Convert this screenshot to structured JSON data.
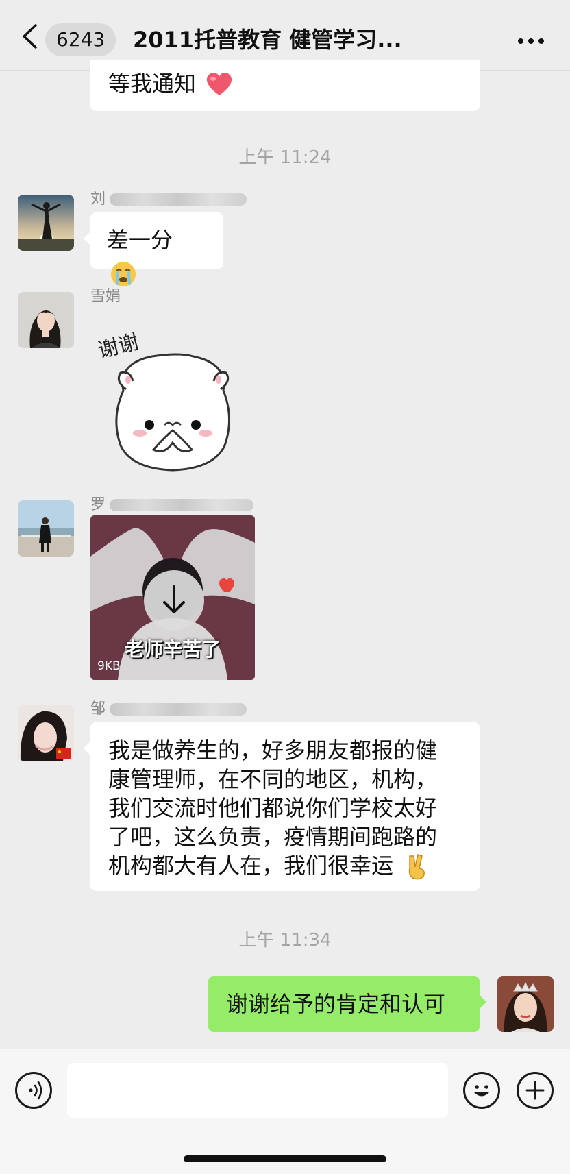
{
  "navbar": {
    "unread_count": "6243",
    "title": "2011托普教育 健管学习..."
  },
  "messages": [
    {
      "type": "text",
      "side": "left",
      "text": "等我通知",
      "emoji": "heart"
    },
    {
      "type": "time",
      "text": "上午 11:24"
    },
    {
      "type": "text",
      "side": "left",
      "sender": "刘",
      "text": "差一分",
      "emoji": "crying-face"
    },
    {
      "type": "sticker",
      "side": "left",
      "sender": "雪娟",
      "sticker_text": "谢谢"
    },
    {
      "type": "video",
      "side": "left",
      "sender": "罗",
      "caption": "老师辛苦了",
      "size": "9KB"
    },
    {
      "type": "text",
      "side": "left",
      "sender": "邹",
      "lines": [
        "我是做养生的，好多朋友都报的健",
        "康管理师，在不同的地区，机构，",
        "我们交流时他们都说你们学校太好",
        "了吧，这么负责，疫情期间跑路的",
        "机构都大有人在，我们很幸运"
      ],
      "emoji": "victory-hand"
    },
    {
      "type": "time",
      "text": "上午 11:34"
    },
    {
      "type": "text",
      "side": "right",
      "text": "谢谢给予的肯定和认可"
    }
  ],
  "colors": {
    "background": "#ededed",
    "self_bubble": "#95ec69",
    "other_bubble": "#ffffff",
    "timestamp": "#a4a4a4"
  },
  "input_bar": {
    "icons": [
      "voice-icon",
      "emoji-icon",
      "plus-icon"
    ]
  }
}
